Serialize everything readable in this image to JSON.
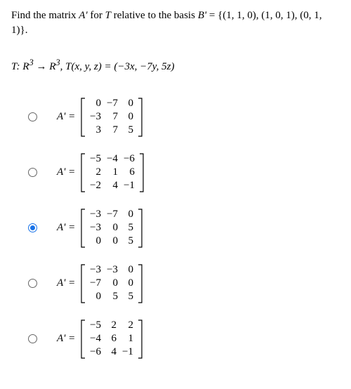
{
  "question_prefix": "Find the matrix ",
  "question_mid1": " for ",
  "question_mid2": " relative to the basis ",
  "basis_label": "B'",
  "basis_eq": " = {(1, 1, 0), (1, 0, 1), (0, 1, 1)}.",
  "aprime": "A'",
  "t_symbol": "T",
  "transform_lhs": "T: R",
  "transform_arrow": " → R",
  "transform_rest": ", T(x, y, z) = (−3x, −7y, 5z)",
  "sup3": "3",
  "eq": " = ",
  "selected_index": 2,
  "options": [
    {
      "rows": [
        [
          "0",
          "−7",
          "0"
        ],
        [
          "−3",
          "7",
          "0"
        ],
        [
          "3",
          "7",
          "5"
        ]
      ]
    },
    {
      "rows": [
        [
          "−5",
          "−4",
          "−6"
        ],
        [
          "2",
          "1",
          "6"
        ],
        [
          "−2",
          "4",
          "−1"
        ]
      ]
    },
    {
      "rows": [
        [
          "−3",
          "−7",
          "0"
        ],
        [
          "−3",
          "0",
          "5"
        ],
        [
          "0",
          "0",
          "5"
        ]
      ]
    },
    {
      "rows": [
        [
          "−3",
          "−3",
          "0"
        ],
        [
          "−7",
          "0",
          "0"
        ],
        [
          "0",
          "5",
          "5"
        ]
      ]
    },
    {
      "rows": [
        [
          "−5",
          "2",
          "2"
        ],
        [
          "−4",
          "6",
          "1"
        ],
        [
          "−6",
          "4",
          "−1"
        ]
      ]
    }
  ]
}
